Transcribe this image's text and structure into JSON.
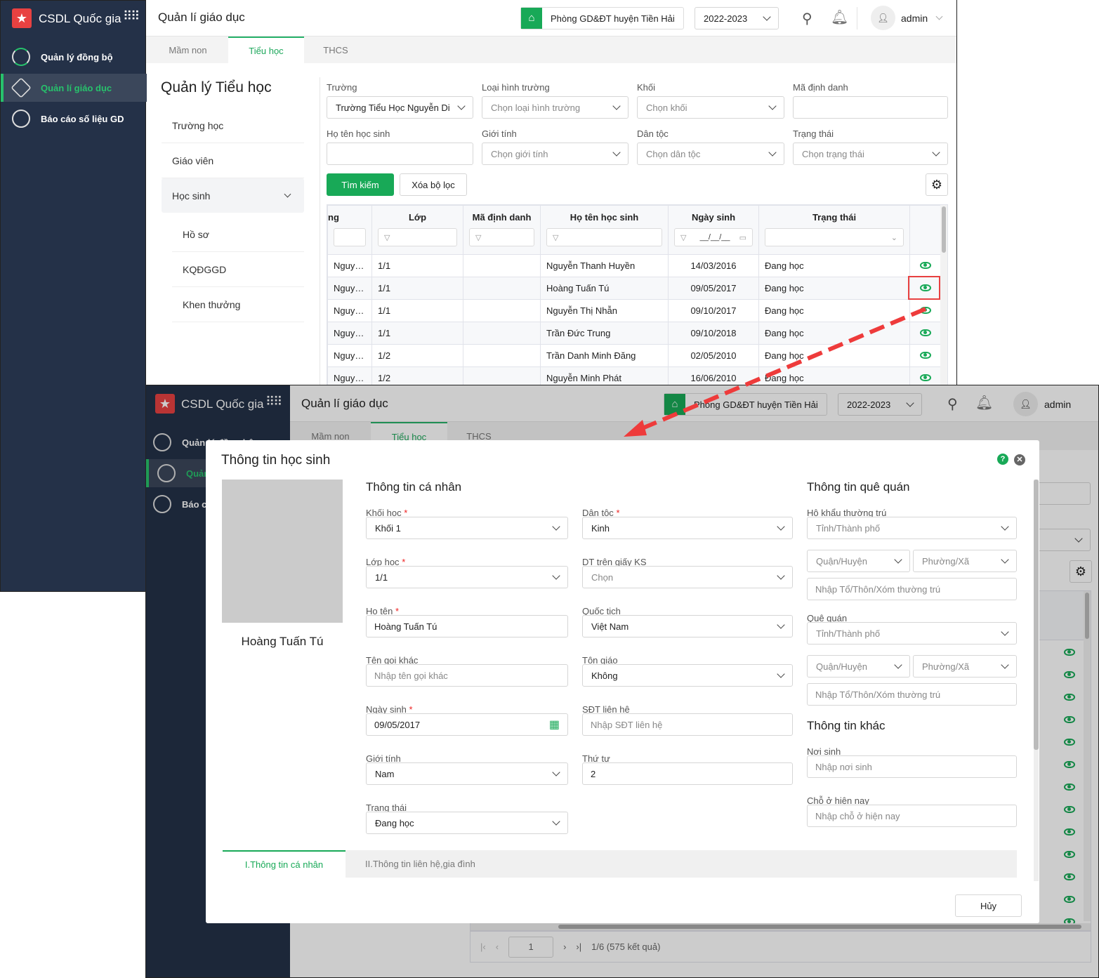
{
  "app": {
    "brand": "CSDL Quốc gia",
    "header_title": "Quản lí giáo dục",
    "org": "Phòng GD&ĐT huyện Tiền Hải",
    "year": "2022-2023",
    "user": "admin"
  },
  "sidebar": {
    "items": [
      {
        "label": "Quản lý đồng bộ"
      },
      {
        "label": "Quản lí giáo dục"
      },
      {
        "label": "Báo cáo số liệu GD"
      }
    ]
  },
  "tabs": [
    {
      "label": "Mầm non"
    },
    {
      "label": "Tiểu học"
    },
    {
      "label": "THCS"
    }
  ],
  "left_panel": {
    "title": "Quản lý Tiểu học",
    "menu": [
      {
        "label": "Trường học"
      },
      {
        "label": "Giáo viên"
      },
      {
        "label": "Học sinh"
      }
    ],
    "submenu": [
      {
        "label": "Hồ sơ"
      },
      {
        "label": "KQĐGGD"
      },
      {
        "label": "Khen thưởng"
      }
    ]
  },
  "filters": {
    "truong": {
      "label": "Trường",
      "value": "Trường Tiểu Học Nguyễn Di"
    },
    "loai_hinh": {
      "label": "Loại hình trường",
      "placeholder": "Chọn loại hình trường"
    },
    "khoi": {
      "label": "Khối",
      "placeholder": "Chọn khối"
    },
    "ma_dinh_danh": {
      "label": "Mã định danh",
      "value": ""
    },
    "ho_ten": {
      "label": "Họ tên học sinh",
      "value": ""
    },
    "gioi_tinh": {
      "label": "Giới tính",
      "placeholder": "Chọn giới tính"
    },
    "dan_toc": {
      "label": "Dân tộc",
      "placeholder": "Chọn dân tộc"
    },
    "trang_thai": {
      "label": "Trạng thái",
      "placeholder": "Chọn trạng thái"
    },
    "search_button": "Tìm kiếm",
    "clear_button": "Xóa bộ lọc"
  },
  "table": {
    "columns": [
      "ng",
      "Lớp",
      "Mã định danh",
      "Họ tên học sinh",
      "Ngày sinh",
      "Trạng thái"
    ],
    "date_placeholder": "__/__/__",
    "rows": [
      {
        "truong": "Nguyễ...",
        "lop": "1/1",
        "ma": "",
        "ten": "Nguyễn Thanh Huyền",
        "ngay_sinh": "14/03/2016",
        "trang_thai": "Đang học"
      },
      {
        "truong": "Nguyễ...",
        "lop": "1/1",
        "ma": "",
        "ten": "Hoàng Tuấn Tú",
        "ngay_sinh": "09/05/2017",
        "trang_thai": "Đang học"
      },
      {
        "truong": "Nguyễ...",
        "lop": "1/1",
        "ma": "",
        "ten": "Nguyễn Thị Nhẫn",
        "ngay_sinh": "09/10/2017",
        "trang_thai": "Đang học"
      },
      {
        "truong": "Nguyễ...",
        "lop": "1/1",
        "ma": "",
        "ten": "Trần Đức Trung",
        "ngay_sinh": "09/10/2018",
        "trang_thai": "Đang học"
      },
      {
        "truong": "Nguyễ...",
        "lop": "1/2",
        "ma": "",
        "ten": "Trần Danh Minh Đăng",
        "ngay_sinh": "02/05/2010",
        "trang_thai": "Đang học"
      },
      {
        "truong": "Nguyễ...",
        "lop": "1/2",
        "ma": "",
        "ten": "Nguyễn Minh Phát",
        "ngay_sinh": "16/06/2010",
        "trang_thai": "Đang học"
      }
    ],
    "pagination": {
      "page": "1",
      "summary": "1/6 (575 kết quả)"
    }
  },
  "dialog": {
    "title": "Thông tin học sinh",
    "student_name": "Hoàng Tuấn Tú",
    "personal_title": "Thông tin cá nhân",
    "khoi_hoc": {
      "label": "Khối học",
      "value": "Khối 1"
    },
    "lop_hoc": {
      "label": "Lớp học",
      "value": "1/1"
    },
    "ho_ten": {
      "label": "Họ tên",
      "value": "Hoàng Tuấn Tú"
    },
    "ten_goi_khac": {
      "label": "Tên gọi khác",
      "placeholder": "Nhập tên gọi khác"
    },
    "ngay_sinh": {
      "label": "Ngày sinh",
      "value": "09/05/2017"
    },
    "gioi_tinh": {
      "label": "Giới tính",
      "value": "Nam"
    },
    "trang_thai": {
      "label": "Trạng thái",
      "value": "Đang học"
    },
    "dan_toc": {
      "label": "Dân tộc",
      "value": "Kinh"
    },
    "dt_giay_ks": {
      "label": "DT trên giấy KS",
      "placeholder": "Chọn"
    },
    "quoc_tich": {
      "label": "Quốc tịch",
      "value": "Việt Nam"
    },
    "ton_giao": {
      "label": "Tôn giáo",
      "value": "Không"
    },
    "sdt": {
      "label": "SĐT liên hệ",
      "placeholder": "Nhập SĐT liên hệ"
    },
    "thu_tu": {
      "label": "Thứ tự",
      "value": "2"
    },
    "hometown_title": "Thông tin quê quán",
    "ho_khau": {
      "label": "Hộ khẩu thường trú",
      "tinh": "Tỉnh/Thành phố",
      "quan": "Quận/Huyện",
      "phuong": "Phường/Xã",
      "detail": "Nhập Tổ/Thôn/Xóm thường trú"
    },
    "que_quan": {
      "label": "Quê quán",
      "tinh": "Tỉnh/Thành phố",
      "quan": "Quận/Huyện",
      "phuong": "Phường/Xã",
      "detail": "Nhập Tổ/Thôn/Xóm thường trú"
    },
    "other_title": "Thông tin khác",
    "noi_sinh": {
      "label": "Nơi sinh",
      "placeholder": "Nhập nơi sinh"
    },
    "cho_o": {
      "label": "Chỗ ở hiện nay",
      "placeholder": "Nhập chỗ ở hiện nay"
    },
    "bottom_tabs": [
      "I.Thông tin cá nhân",
      "II.Thông tin liên hệ,gia đình"
    ],
    "cancel_button": "Hủy",
    "required_mark": "*"
  },
  "colors": {
    "accent": "#18a957",
    "sidebar": "#243148",
    "highlight": "#e84141"
  }
}
